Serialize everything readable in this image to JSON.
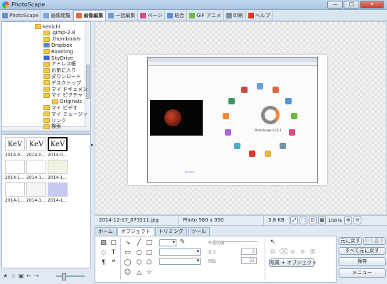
{
  "app": {
    "title": "PhotoScape"
  },
  "window_buttons": {
    "minimize": "—",
    "maximize": "□",
    "close": "✕"
  },
  "tabs": [
    {
      "label": "PhotoScape",
      "icon": "photoscape-icon",
      "color": "#6a8fc8"
    },
    {
      "label": "画像閲覧",
      "icon": "viewer-icon",
      "color": "#7aa7d8"
    },
    {
      "label": "画像編集",
      "icon": "editor-icon",
      "color": "#e06a3a",
      "active": true
    },
    {
      "label": "一括編集",
      "icon": "batch-icon",
      "color": "#6aa0d8"
    },
    {
      "label": "ページ",
      "icon": "page-icon",
      "color": "#d84a8a"
    },
    {
      "label": "結合",
      "icon": "combine-icon",
      "color": "#5a8fd0"
    },
    {
      "label": "GIF アニメ",
      "icon": "gif-icon",
      "color": "#6ab84a"
    },
    {
      "label": "印刷",
      "icon": "print-icon",
      "color": "#7a8fa8"
    },
    {
      "label": "ヘルプ",
      "icon": "help-icon",
      "color": "#d83a2a"
    }
  ],
  "tree": [
    "kenichi",
    ".gimp-2.8",
    ".thumbnails",
    "Dropbox",
    "Roaming",
    "SkyDrive",
    "アドレス帳",
    "お気に入り",
    "ダウンロード",
    "デスクトップ",
    "マイ ドキュメン",
    "マイ ピクチャ",
    "Originals",
    "マイ ビデオ",
    "マイ ミュージッ",
    "リンク",
    "検索"
  ],
  "thumbs": [
    {
      "caption": "2014-0...",
      "glyph": "KeV"
    },
    {
      "caption": "2014-0...",
      "glyph": "KeV"
    },
    {
      "caption": "2014-0...",
      "glyph": "KeV"
    },
    {
      "caption": "2014-1...",
      "glyph": ""
    },
    {
      "caption": "2014-1...",
      "glyph": ""
    },
    {
      "caption": "2014-1...",
      "glyph": ""
    },
    {
      "caption": "2014-1...",
      "glyph": ""
    },
    {
      "caption": "2014-1...",
      "glyph": ""
    },
    {
      "caption": "2014-1...",
      "glyph": ""
    }
  ],
  "photo": {
    "logo_text": "PhotoScape v3.6.3",
    "footer": "Donation"
  },
  "status": {
    "filename": "2014-12-17_073211.jpg",
    "dimensions": "Photo 580 x 350",
    "filesize": "3.8 KB",
    "zoom": "100%"
  },
  "subtabs": [
    "ホーム",
    "オブジェクト",
    "トリミング",
    "ツール"
  ],
  "edit": {
    "opacity_label": "不透明度",
    "width_label": "太さ",
    "rotate_label": "回転",
    "width_value": "3",
    "rotate_value": "32",
    "photo_object_button": "写真 + オブジェクト"
  },
  "right_buttons": {
    "undo": "元に戻す",
    "redo": "やり直す",
    "undo_all": "すべて元に戻す",
    "save": "保存",
    "menu": "メニュー"
  }
}
